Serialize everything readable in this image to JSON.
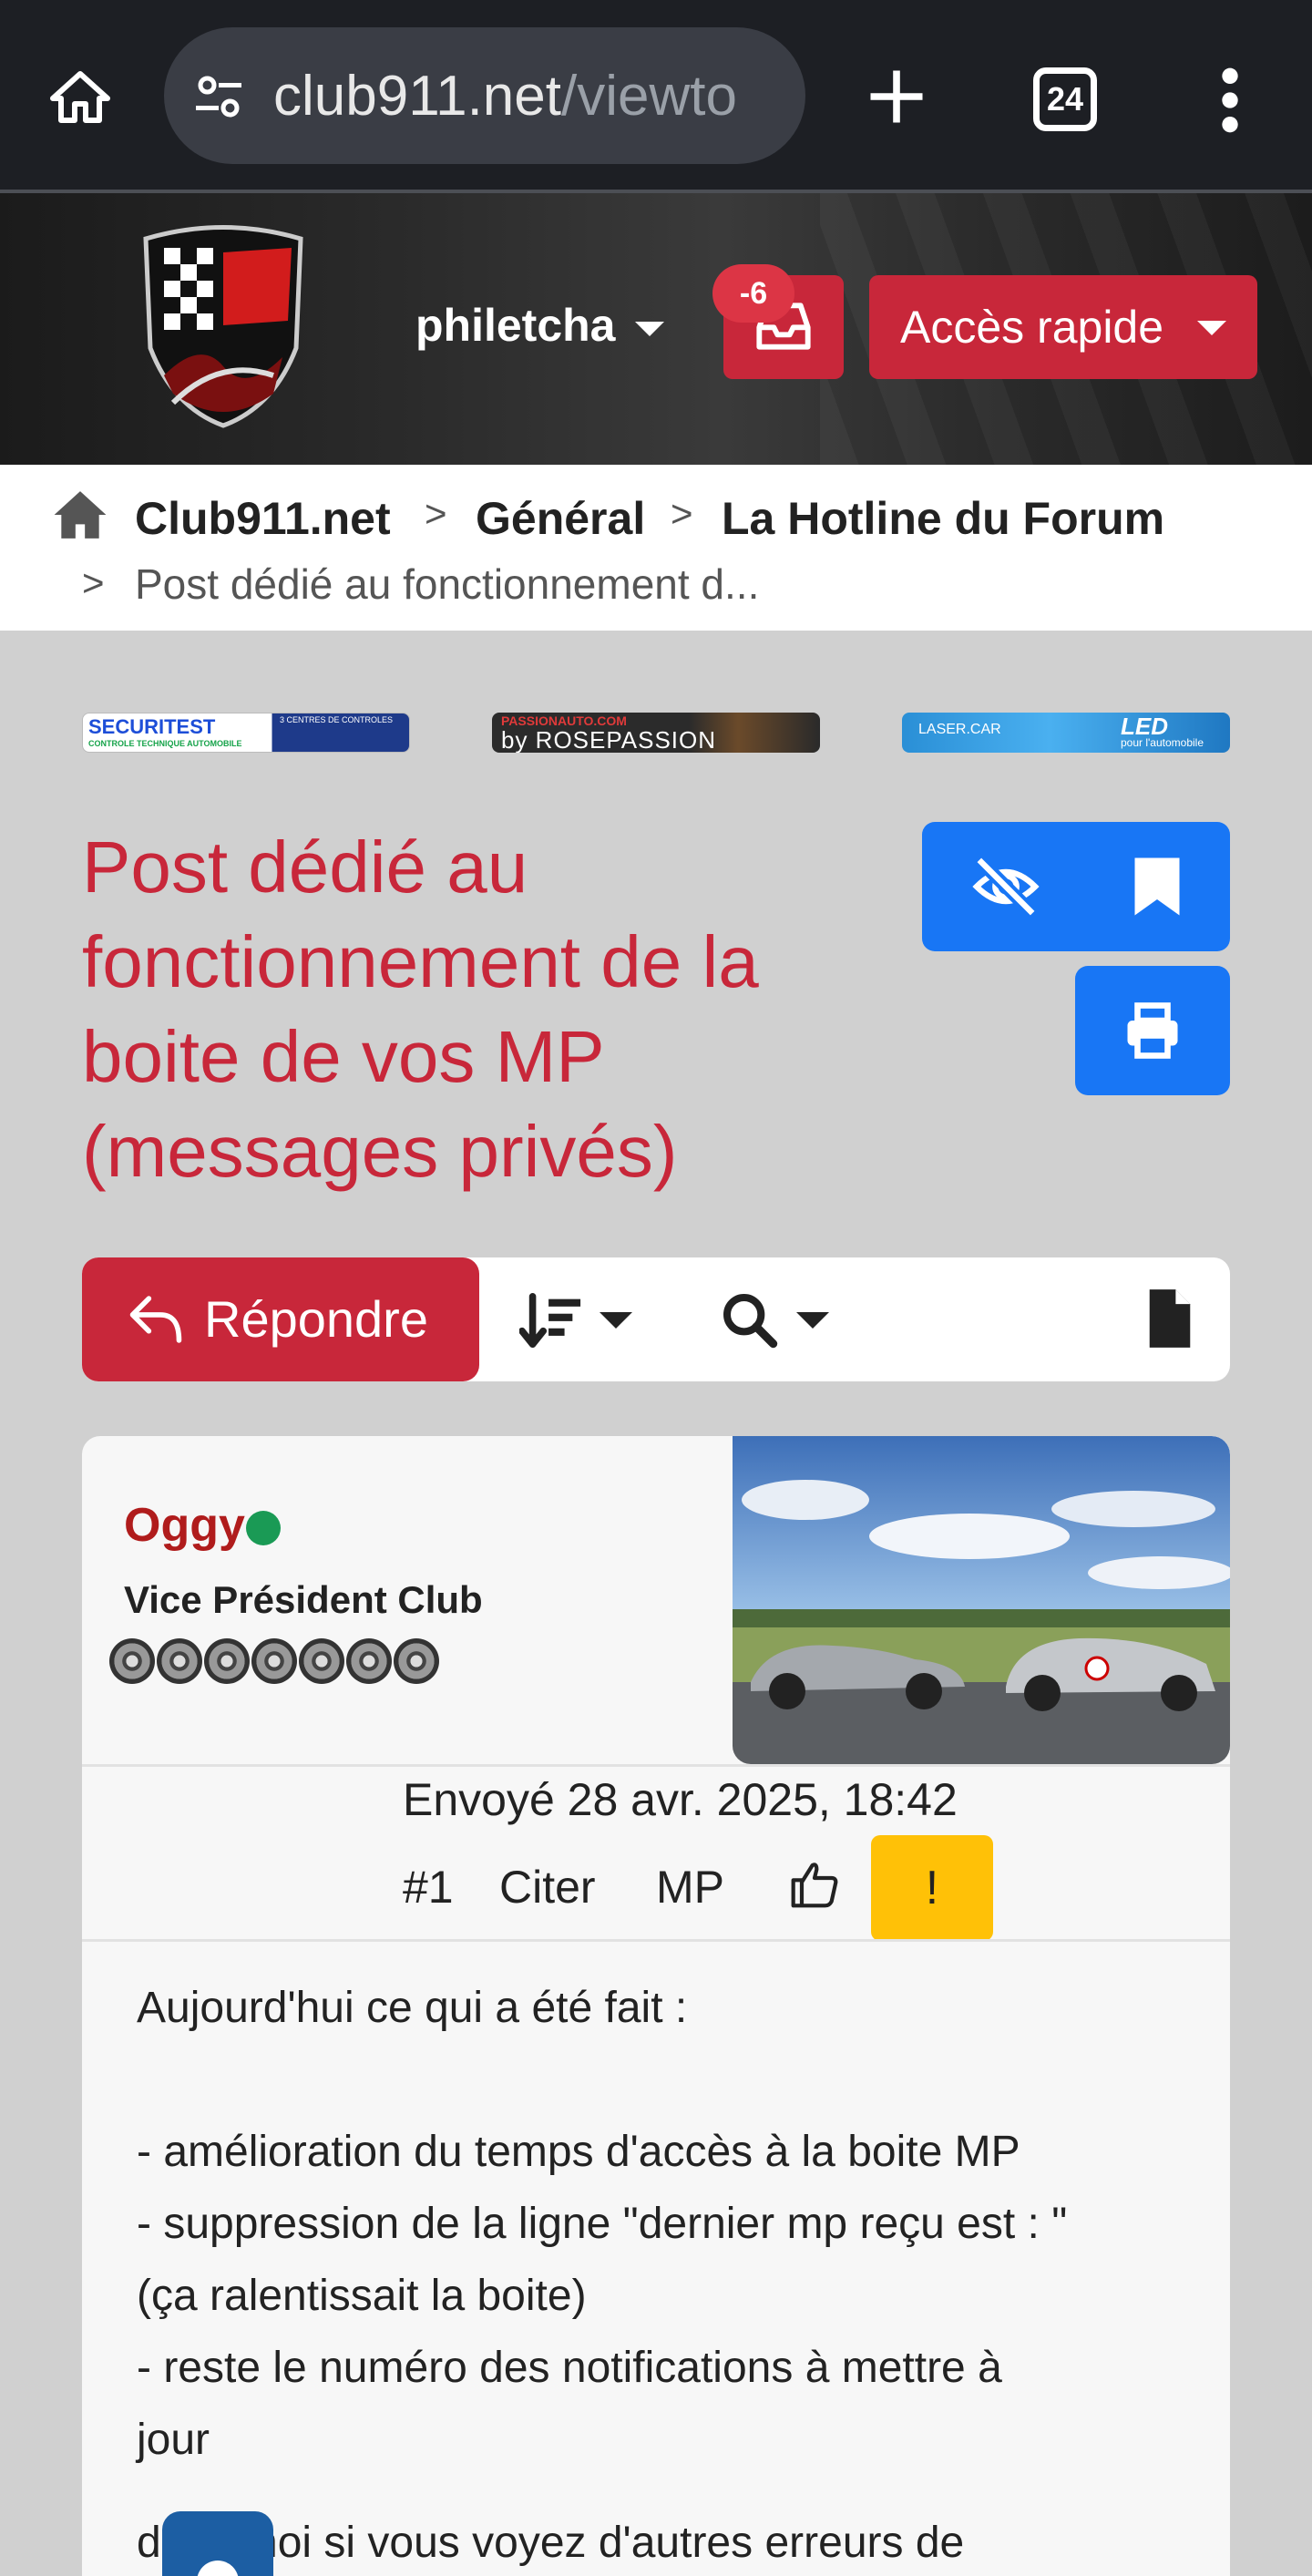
{
  "browser": {
    "url_domain": "club911.net",
    "url_path": "/viewto",
    "tab_count": "24"
  },
  "header": {
    "username": "philetcha",
    "inbox_badge": "-6",
    "quick_access": "Accès rapide"
  },
  "breadcrumb": {
    "items": [
      "Club911.net",
      "Général",
      "La Hotline du Forum"
    ],
    "current": "Post dédié au fonctionnement d..."
  },
  "ads": {
    "ad1_title": "SECURITEST",
    "ad1_sub": "CONTROLE TECHNIQUE AUTOMOBILE",
    "ad1_right": "3 CENTRES DE CONTROLES",
    "ad2_top": "PASSIONAUTO.COM",
    "ad2_main": "by ROSEPASSION",
    "ad3_left": "LASER.CAR",
    "ad3_main": "LED",
    "ad3_sub": "pour l'automobile"
  },
  "topic": {
    "title": "Post dédié au fonctionnement de la boite de vos MP (messages privés)"
  },
  "actions": {
    "reply_label": "Répondre"
  },
  "post": {
    "author": "Oggy",
    "rank": "Vice Président Club",
    "date": "Envoyé 28 avr. 2025, 18:42",
    "number": "#1",
    "quote_label": "Citer",
    "mp_label": "MP",
    "report_label": "!",
    "lines": [
      "Aujourd'hui ce qui a été fait :",
      "- amélioration du temps d'accès à la boite MP",
      "- suppression de la ligne \"dernier mp reçu est : \"",
      "(ça ralentissait la boite)",
      "- reste le numéro des notifications à mettre à",
      "jour"
    ],
    "partial_line": "dites moi si vous voyez d'autres erreurs de"
  }
}
